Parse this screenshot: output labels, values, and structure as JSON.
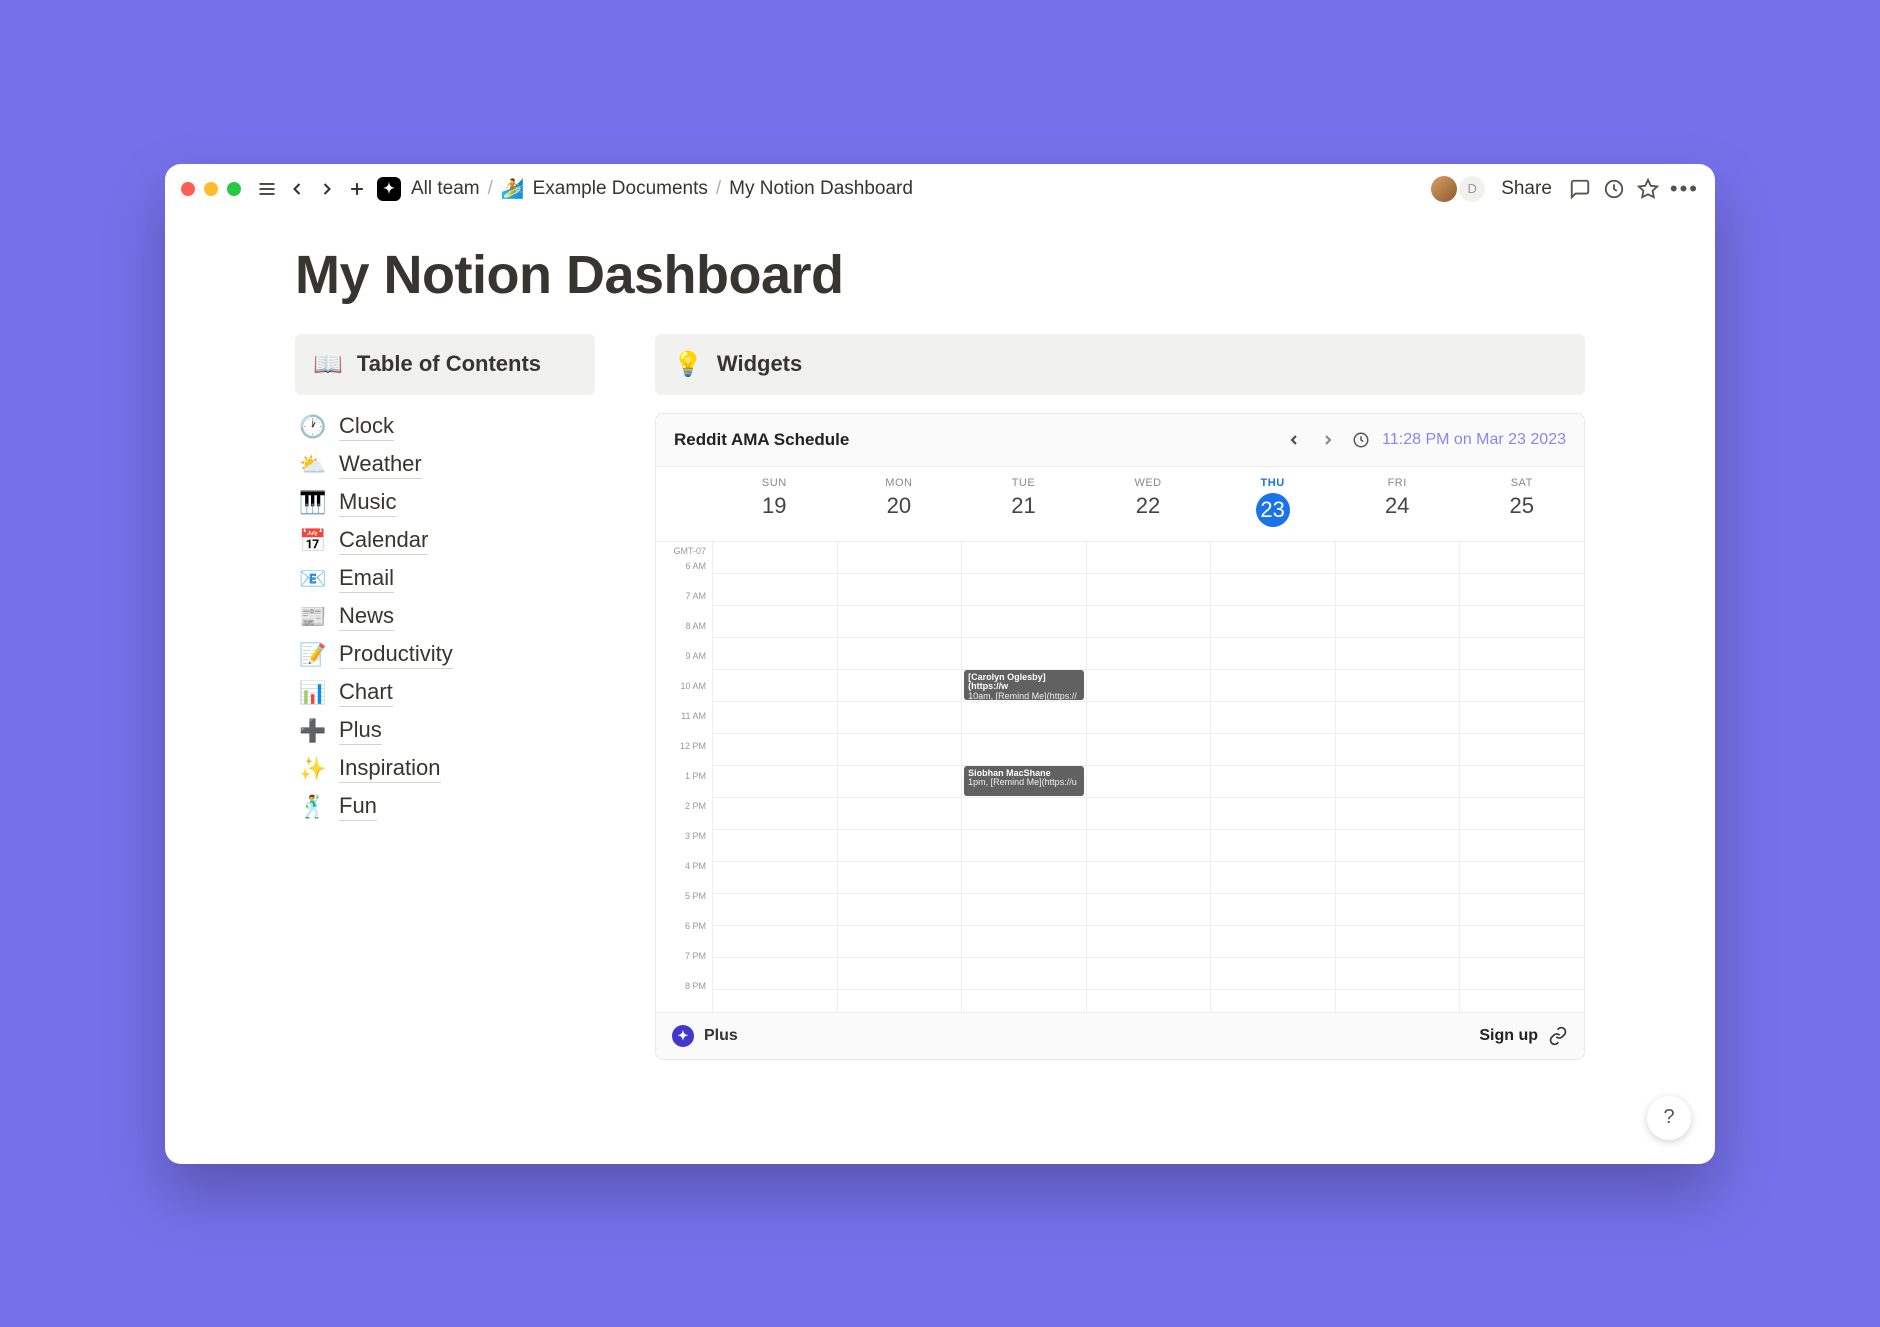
{
  "breadcrumb": {
    "team": "All team",
    "folder_emoji": "🏄",
    "folder": "Example Documents",
    "page": "My Notion Dashboard"
  },
  "topbar": {
    "share": "Share",
    "avatar_badge": "D"
  },
  "page": {
    "title": "My Notion Dashboard"
  },
  "toc_header": {
    "emoji": "📖",
    "label": "Table of Contents"
  },
  "toc": [
    {
      "emoji": "🕐",
      "label": "Clock"
    },
    {
      "emoji": "⛅",
      "label": "Weather"
    },
    {
      "emoji": "🎹",
      "label": "Music"
    },
    {
      "emoji": "📅",
      "label": "Calendar"
    },
    {
      "emoji": "📧",
      "label": "Email"
    },
    {
      "emoji": "📰",
      "label": "News"
    },
    {
      "emoji": "📝",
      "label": "Productivity"
    },
    {
      "emoji": "📊",
      "label": "Chart"
    },
    {
      "emoji": "➕",
      "label": "Plus"
    },
    {
      "emoji": "✨",
      "label": "Inspiration"
    },
    {
      "emoji": "🕺",
      "label": "Fun"
    }
  ],
  "widgets_header": {
    "emoji": "💡",
    "label": "Widgets"
  },
  "calendar": {
    "title": "Reddit AMA Schedule",
    "timestamp": "11:28 PM on Mar 23 2023",
    "tz": "GMT-07",
    "days": [
      {
        "dw": "SUN",
        "dn": "19"
      },
      {
        "dw": "MON",
        "dn": "20"
      },
      {
        "dw": "TUE",
        "dn": "21"
      },
      {
        "dw": "WED",
        "dn": "22"
      },
      {
        "dw": "THU",
        "dn": "23",
        "today": true
      },
      {
        "dw": "FRI",
        "dn": "24"
      },
      {
        "dw": "SAT",
        "dn": "25"
      }
    ],
    "hours": [
      "6 AM",
      "7 AM",
      "8 AM",
      "9 AM",
      "10 AM",
      "11 AM",
      "12 PM",
      "1 PM",
      "2 PM",
      "3 PM",
      "4 PM",
      "5 PM",
      "6 PM",
      "7 PM",
      "8 PM"
    ],
    "events": [
      {
        "title": "[Carolyn Oglesby](https://w",
        "sub": "10am, [Remind Me](https://"
      },
      {
        "title": "Siobhan MacShane",
        "sub": "1pm, [Remind Me](https://u"
      }
    ],
    "footer": {
      "brand": "Plus",
      "signup": "Sign up"
    }
  },
  "help": "?"
}
